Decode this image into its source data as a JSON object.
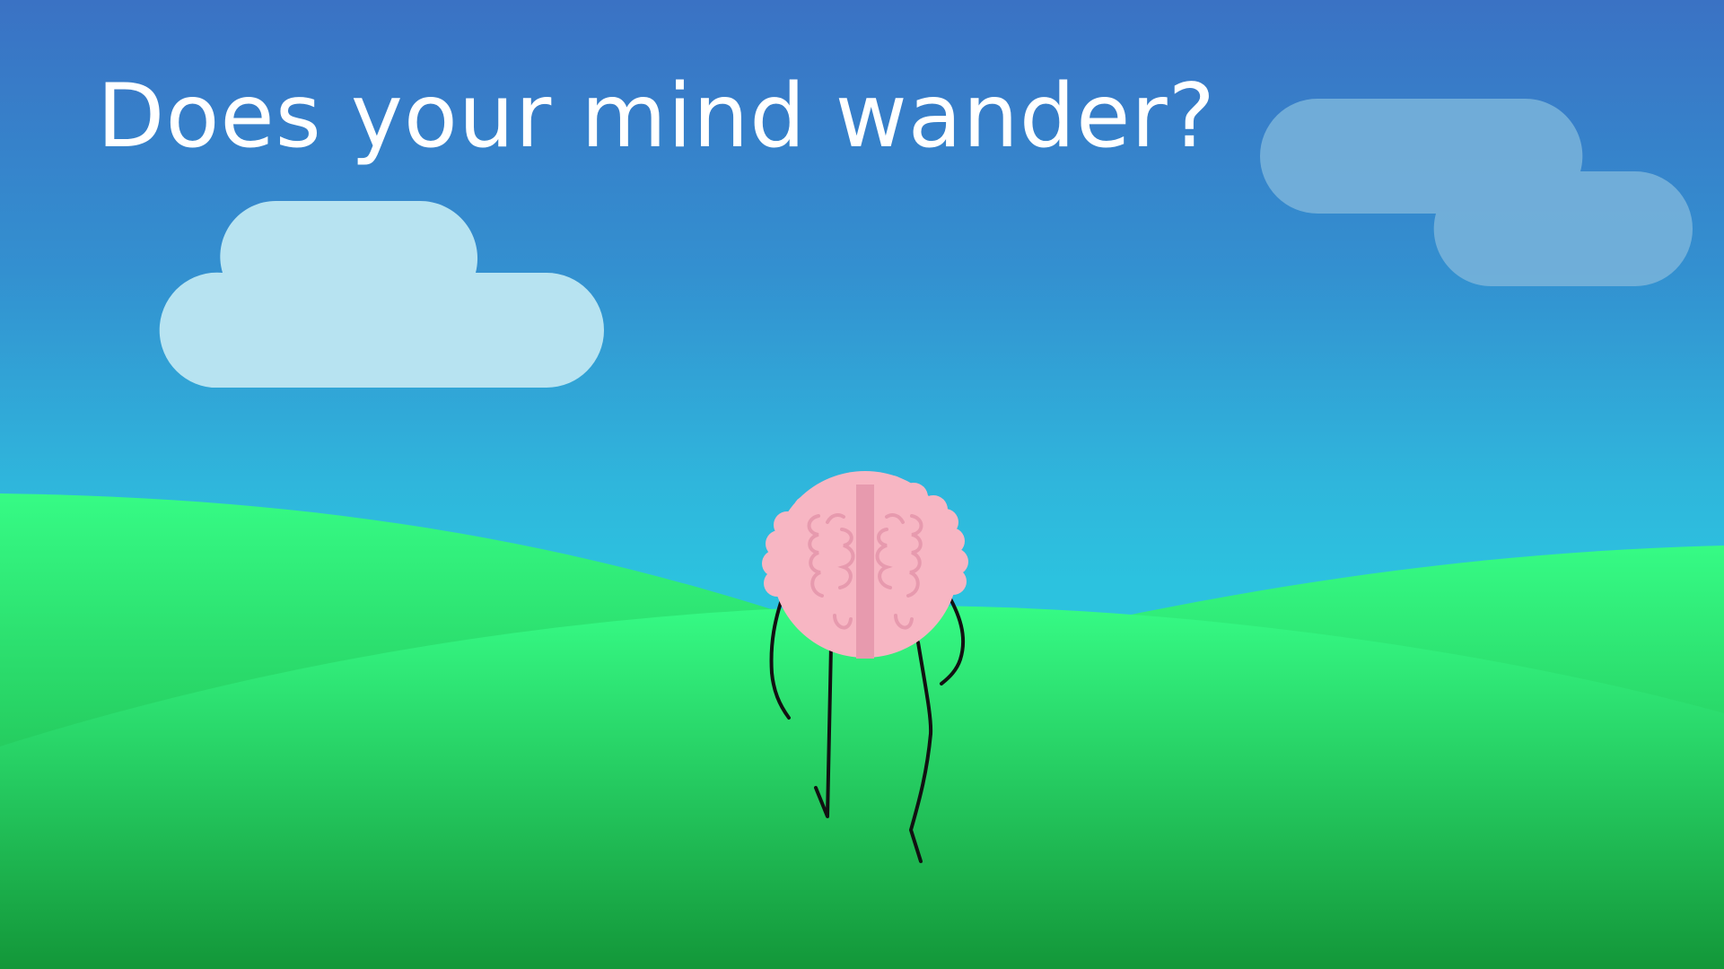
{
  "scene": {
    "headline": "Does your mind wander?"
  },
  "colors": {
    "sky_top": "#3a72c4",
    "sky_bottom": "#2cc2df",
    "cloud_light": "#b7e3f1",
    "cloud_faded": "#7ab4da",
    "grass_light": "#36fb85",
    "grass_dark": "#139739",
    "brain_pink": "#f7b6c3",
    "brain_fold": "#e79aae",
    "limb": "#111111"
  },
  "icons": {
    "character": "brain-character-icon",
    "cloud": "cloud-icon"
  }
}
